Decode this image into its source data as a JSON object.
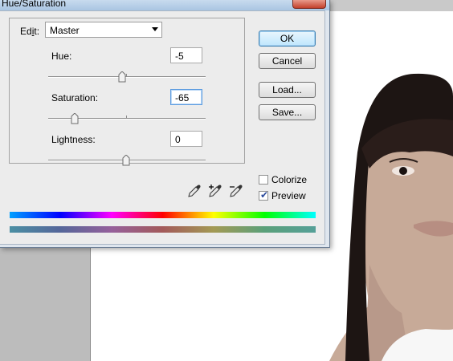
{
  "window": {
    "title": "Hue/Saturation"
  },
  "edit": {
    "label_prefix": "Ed",
    "label_mnemonic": "i",
    "label_suffix": "t:",
    "selected": "Master"
  },
  "sliders": {
    "hue": {
      "label": "Hue:",
      "value": "-5",
      "level": 0.49
    },
    "saturation": {
      "label": "Saturation:",
      "value": "-65",
      "level": 0.17
    },
    "lightness": {
      "label": "Lightness:",
      "value": "0",
      "level": 0.5
    }
  },
  "buttons": {
    "ok": "OK",
    "cancel": "Cancel",
    "load": "Load...",
    "save": "Save..."
  },
  "options": {
    "colorize": {
      "label": "Colorize",
      "checked": false
    },
    "preview": {
      "label": "Preview",
      "checked": true
    }
  },
  "icons": [
    "eyedropper-icon",
    "eyedropper-plus-icon",
    "eyedropper-minus-icon"
  ],
  "colors": {
    "default_button": "#3c7fb1",
    "titlebar": "#a9c5e2",
    "close_button": "#c2402b"
  }
}
